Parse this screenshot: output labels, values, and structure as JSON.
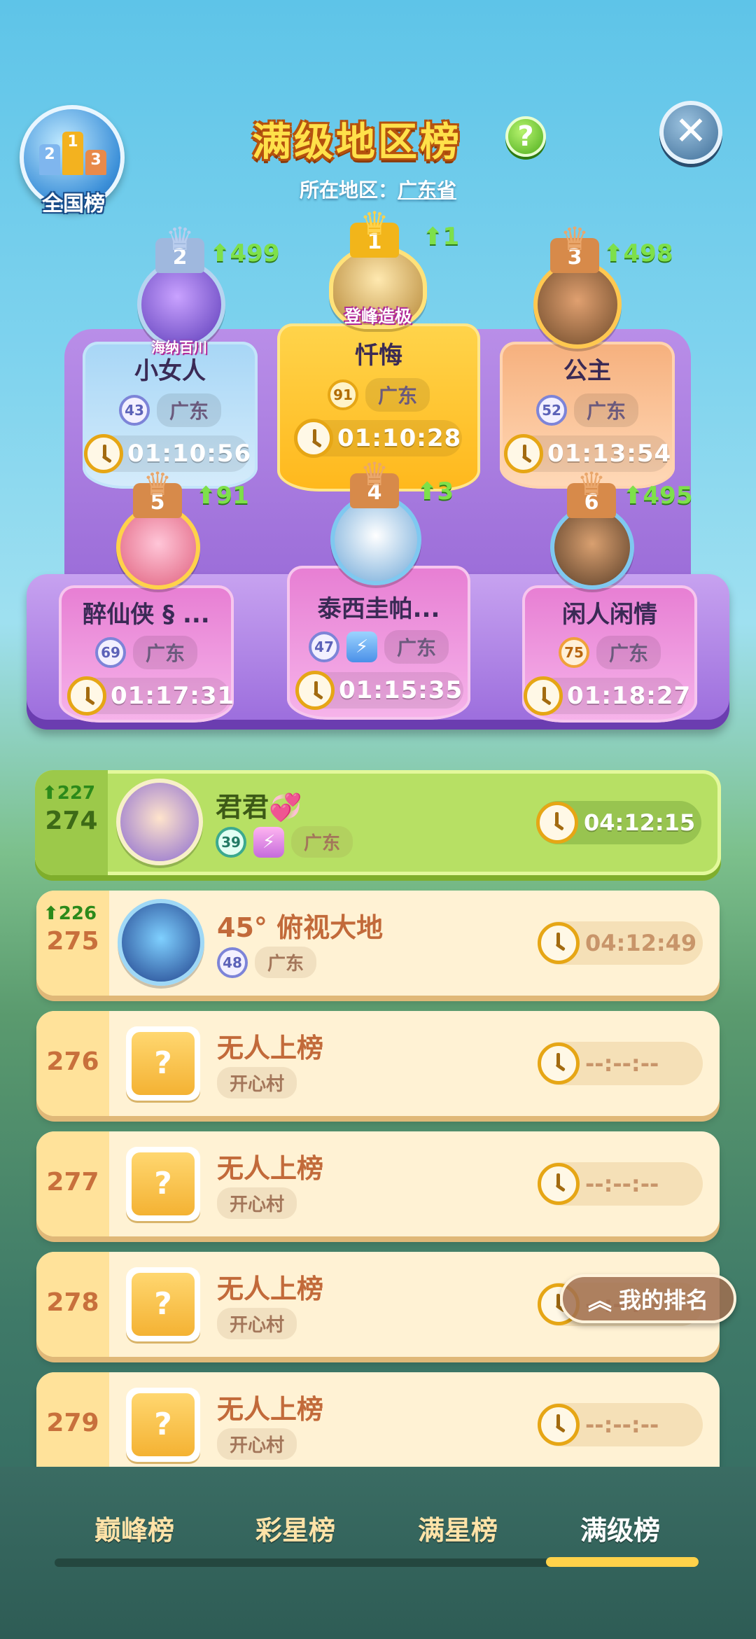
{
  "header": {
    "national_label": "全国榜",
    "title": "满级地区榜",
    "help": "?",
    "close": "✕",
    "region_prefix": "所在地区：",
    "region_value": "广东省"
  },
  "top_players": [
    {
      "rank": "2",
      "up": "499",
      "badge": "海纳百川",
      "name": "小女人",
      "level": "43",
      "region": "广东",
      "time": "01:10:56"
    },
    {
      "rank": "1",
      "up": "1",
      "badge": "登峰造极",
      "name": "忏悔",
      "level": "91",
      "region": "广东",
      "time": "01:10:28"
    },
    {
      "rank": "3",
      "up": "498",
      "name": "公主",
      "level": "52",
      "region": "广东",
      "time": "01:13:54"
    },
    {
      "rank": "5",
      "up": "91",
      "name": "醉仙侠 § ...",
      "level": "69",
      "region": "广东",
      "time": "01:17:31"
    },
    {
      "rank": "4",
      "up": "3",
      "name": "泰西圭帕...",
      "level": "47",
      "region": "广东",
      "time": "01:15:35"
    },
    {
      "rank": "6",
      "up": "495",
      "name": "闲人闲情",
      "level": "75",
      "region": "广东",
      "time": "01:18:27"
    }
  ],
  "rows": [
    {
      "rank": "274",
      "up": "227",
      "name": "君君💞",
      "level": "39",
      "region": "广东",
      "time": "04:12:15"
    },
    {
      "rank": "275",
      "up": "226",
      "name": "45° 俯视大地",
      "level": "48",
      "region": "广东",
      "time": "04:12:49"
    },
    {
      "rank": "276",
      "name": "无人上榜",
      "region": "开心村",
      "time": "--:--:--"
    },
    {
      "rank": "277",
      "name": "无人上榜",
      "region": "开心村",
      "time": "--:--:--"
    },
    {
      "rank": "278",
      "name": "无人上榜",
      "region": "开心村",
      "time": "--:--:--"
    },
    {
      "rank": "279",
      "name": "无人上榜",
      "region": "开心村",
      "time": "--:--:--"
    }
  ],
  "my_rank_button": "我的排名",
  "tabs": [
    "巅峰榜",
    "彩星榜",
    "满星榜",
    "满级榜"
  ],
  "active_tab": "满级榜",
  "colors": {
    "accent": "#ffd24a",
    "up_arrow": "#7ee04a",
    "mine_row": "#b7e064",
    "row": "#fff2d4"
  }
}
